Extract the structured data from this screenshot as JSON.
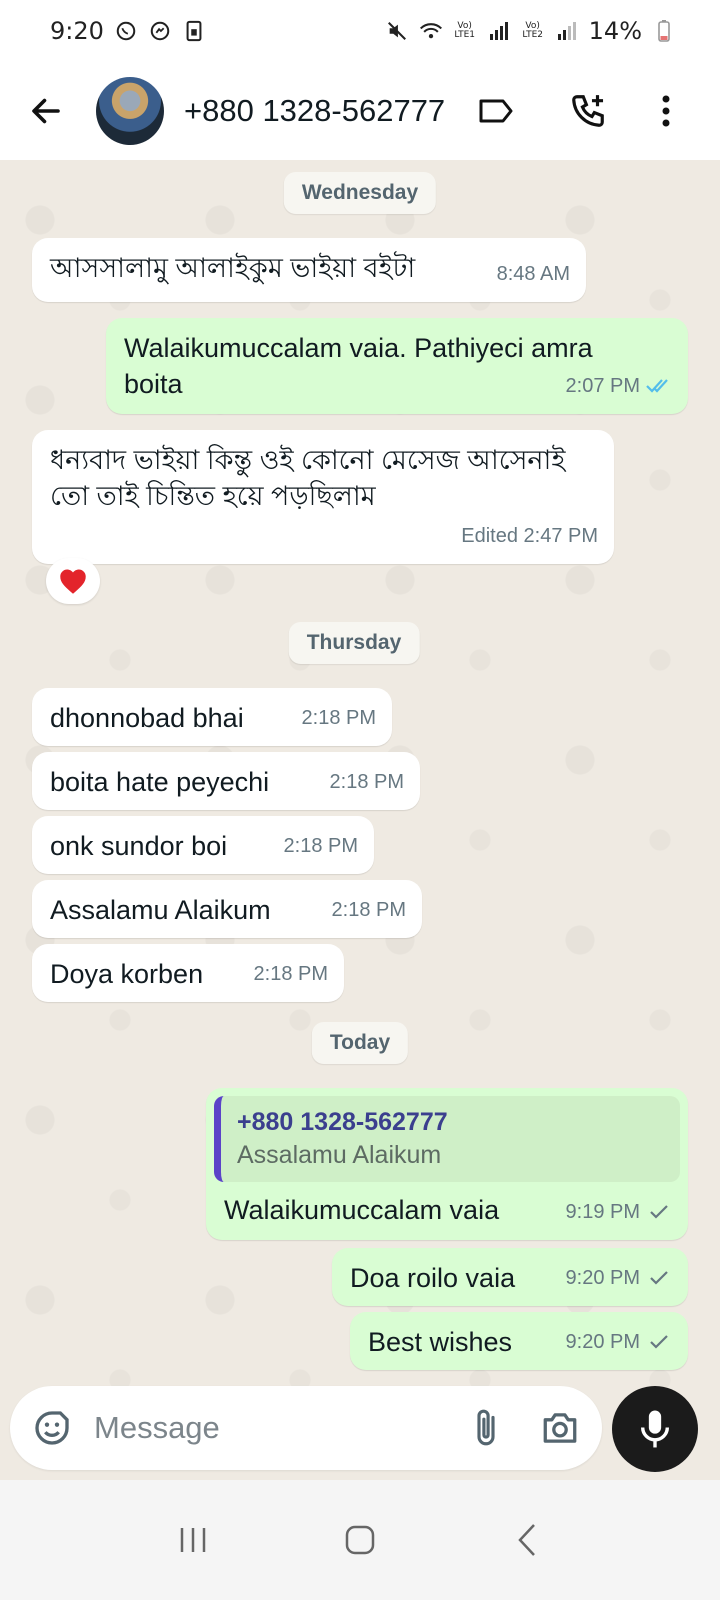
{
  "status_bar": {
    "time": "9:20",
    "lte1_label": "Vo) LTE1",
    "lte2_label": "Vo) LTE2",
    "battery": "14%"
  },
  "header": {
    "contact_name": "+880 1328-562777"
  },
  "chat": {
    "day_wednesday": "Wednesday",
    "day_thursday": "Thursday",
    "day_today": "Today",
    "messages": [
      {
        "dir": "in",
        "text": "আসসালামু আলাইকুম ভাইয়া বইটা",
        "time": "8:48 AM"
      },
      {
        "dir": "out",
        "text": "Walaikumuccalam vaia. Pathiyeci amra boita",
        "time": "2:07 PM",
        "status": "read"
      },
      {
        "dir": "in",
        "text": "ধন্যবাদ ভাইয়া কিন্তু ওই কোনো মেসেজ আসেনাই তো তাই চিন্তিত হয়ে পড়ছিলাম",
        "time": "Edited 2:47 PM",
        "reaction": "❤️"
      },
      {
        "dir": "in",
        "text": "dhonnobad bhai",
        "time": "2:18 PM"
      },
      {
        "dir": "in",
        "text": "boita hate peyechi",
        "time": "2:18 PM"
      },
      {
        "dir": "in",
        "text": "onk sundor boi",
        "time": "2:18 PM"
      },
      {
        "dir": "in",
        "text": "Assalamu Alaikum",
        "time": "2:18 PM"
      },
      {
        "dir": "in",
        "text": "Doya korben",
        "time": "2:18 PM"
      },
      {
        "dir": "out",
        "text": "Walaikumuccalam vaia",
        "time": "9:19 PM",
        "status": "sent",
        "quote": {
          "name": "+880 1328-562777",
          "text": "Assalamu Alaikum"
        }
      },
      {
        "dir": "out",
        "text": "Doa roilo vaia",
        "time": "9:20 PM",
        "status": "sent"
      },
      {
        "dir": "out",
        "text": "Best wishes",
        "time": "9:20 PM",
        "status": "sent"
      }
    ]
  },
  "input": {
    "placeholder": "Message"
  },
  "colors": {
    "chat_bg": "#efeae2",
    "incoming_bubble": "#ffffff",
    "outgoing_bubble": "#d9fdd3",
    "read_tick": "#53bdeb",
    "quote_bar": "#5b43c8"
  },
  "icons": [
    "whatsapp-icon",
    "messenger-icon",
    "sim-icon",
    "mute-icon",
    "wifi-icon",
    "signal-icon",
    "battery-icon",
    "back-arrow-icon",
    "label-icon",
    "add-call-icon",
    "more-options-icon",
    "heart-icon",
    "emoji-sticker-icon",
    "attach-icon",
    "camera-icon",
    "mic-icon",
    "recent-apps-icon",
    "home-icon",
    "nav-back-icon"
  ]
}
